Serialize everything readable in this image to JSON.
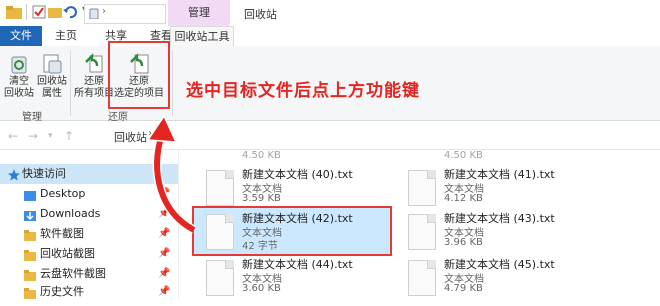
{
  "window": {
    "title": "回收站",
    "context_tab_group": "管理"
  },
  "ribbon_tabs": [
    {
      "label": "文件"
    },
    {
      "label": "主页"
    },
    {
      "label": "共享"
    },
    {
      "label": "查看"
    },
    {
      "label": "回收站工具"
    }
  ],
  "ribbon": {
    "manage_group": {
      "label": "管理",
      "buttons": [
        {
          "line1": "清空",
          "line2": "回收站",
          "icon": "empty-bin-icon"
        },
        {
          "line1": "回收站",
          "line2": "属性",
          "icon": "bin-properties-icon"
        }
      ]
    },
    "restore_group": {
      "label": "还原",
      "buttons": [
        {
          "line1": "还原",
          "line2": "所有项目",
          "icon": "restore-all-icon"
        },
        {
          "line1": "还原",
          "line2": "选定的项目",
          "icon": "restore-selected-icon"
        }
      ]
    }
  },
  "annotation": {
    "text": "选中目标文件后点上方功能键",
    "color": "#e52521"
  },
  "address": {
    "path": "回收站",
    "separator": "›"
  },
  "nav": {
    "items": [
      {
        "label": "快速访问",
        "icon": "star-icon",
        "pinned": false
      },
      {
        "label": "Desktop",
        "icon": "desktop-folder-icon",
        "pinned": true
      },
      {
        "label": "Downloads",
        "icon": "download-folder-icon",
        "pinned": true
      },
      {
        "label": "软件截图",
        "icon": "folder-icon",
        "pinned": true
      },
      {
        "label": "回收站截图",
        "icon": "folder-icon",
        "pinned": true
      },
      {
        "label": "云盘软件截图",
        "icon": "folder-icon",
        "pinned": true
      },
      {
        "label": "历史文件",
        "icon": "folder-icon",
        "pinned": true
      }
    ],
    "pin_glyph": "📌"
  },
  "files": [
    {
      "name": "新建文本文档 (40).txt",
      "type": "文本文档",
      "size": "3.59 KB",
      "selected": false
    },
    {
      "name": "新建文本文档 (41).txt",
      "type": "文本文档",
      "size": "4.12 KB",
      "selected": false
    },
    {
      "name": "新建文本文档 (42).txt",
      "type": "文本文档",
      "size": "42 字节",
      "selected": true
    },
    {
      "name": "新建文本文档 (43).txt",
      "type": "文本文档",
      "size": "3.96 KB",
      "selected": false
    },
    {
      "name": "新建文本文档 (44).txt",
      "type": "文本文档",
      "size": "3.60 KB",
      "selected": false
    },
    {
      "name": "新建文本文档 (45).txt",
      "type": "文本文档",
      "size": "4.79 KB",
      "selected": false
    }
  ],
  "partial_top": {
    "left": "4.50 KB",
    "right": "4.50 KB"
  },
  "colors": {
    "file_tab": "#1f66b6",
    "manage_tab": "#f2d9f4",
    "selection": "#cce8ff",
    "highlight": "#e53935"
  }
}
